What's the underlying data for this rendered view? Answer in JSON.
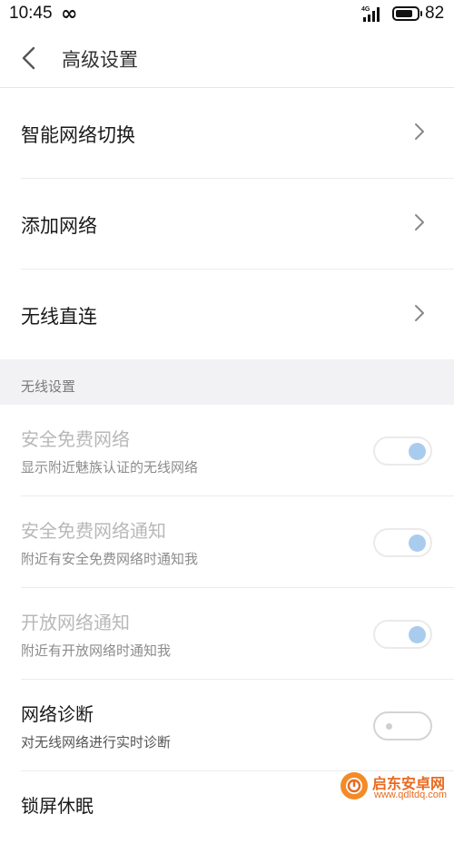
{
  "status_bar": {
    "time": "10:45",
    "infinity": "∞",
    "network": "4G",
    "battery_level": "82",
    "battery_fraction": 0.82
  },
  "header": {
    "title": "高级设置"
  },
  "nav_items": [
    {
      "label": "智能网络切换"
    },
    {
      "label": "添加网络"
    },
    {
      "label": "无线直连"
    }
  ],
  "section": {
    "label": "无线设置"
  },
  "toggles": [
    {
      "title": "安全免费网络",
      "subtitle": "显示附近魅族认证的无线网络",
      "on": true,
      "enabled": false
    },
    {
      "title": "安全免费网络通知",
      "subtitle": "附近有安全免费网络时通知我",
      "on": true,
      "enabled": false
    },
    {
      "title": "开放网络通知",
      "subtitle": "附近有开放网络时通知我",
      "on": true,
      "enabled": false
    },
    {
      "title": "网络诊断",
      "subtitle": "对无线网络进行实时诊断",
      "on": false,
      "enabled": true
    },
    {
      "title": "锁屏休眠",
      "subtitle": "",
      "on": false,
      "enabled": true
    }
  ],
  "watermark": {
    "name": "启东安卓网",
    "url": "www.qdltdq.com"
  },
  "colors": {
    "accent_knob": "#a9ccee",
    "watermark": "#e86a20"
  }
}
